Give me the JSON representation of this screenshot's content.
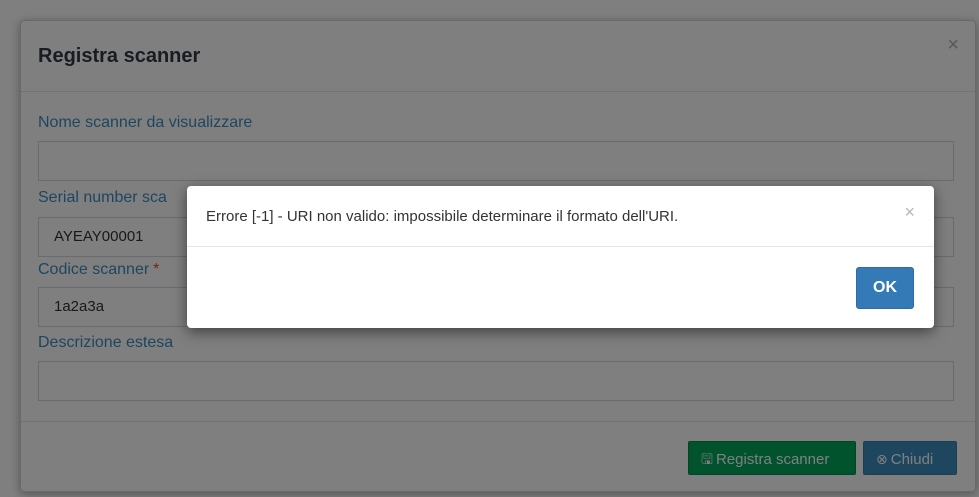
{
  "outer_modal": {
    "title": "Registra scanner",
    "close_glyph": "×",
    "fields": [
      {
        "label": "Nome scanner da visualizzare",
        "value": "",
        "required": false
      },
      {
        "label": "Serial number sca",
        "value": "AYEAY00001",
        "required": false
      },
      {
        "label": "Codice scanner",
        "value": "1a2a3a",
        "required": true,
        "required_mark": "*"
      },
      {
        "label": "Descrizione estesa",
        "value": "",
        "required": false
      }
    ],
    "register_button": {
      "icon": "save-icon",
      "glyph": "🖫",
      "label": "Registra scanner"
    },
    "close_button": {
      "icon": "circle-x-icon",
      "glyph": "⊗",
      "label": "Chiudi"
    }
  },
  "alert": {
    "message": "Errore [-1] - URI non valido: impossibile determinare il formato dell'URI.",
    "close_glyph": "×",
    "ok_label": "OK"
  },
  "colors": {
    "label_blue": "#3c8dbc",
    "success_green": "#00a65a",
    "primary_blue": "#3c8dbc",
    "ok_blue": "#337ab7",
    "required_red": "#dd4b39"
  }
}
